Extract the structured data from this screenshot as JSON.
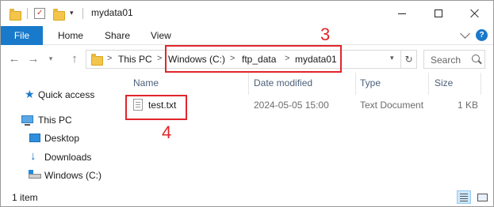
{
  "window": {
    "title": "mydata01",
    "controls": {
      "minimize": "minimize",
      "maximize": "maximize",
      "close": "close"
    }
  },
  "ribbon": {
    "tabs": [
      "File",
      "Home",
      "Share",
      "View"
    ],
    "help_label": "?"
  },
  "address": {
    "root": "This PC",
    "path": [
      "Windows (C:)",
      "ftp_data",
      "mydata01"
    ],
    "separator": ">",
    "search_placeholder": "Search"
  },
  "nav_pane": {
    "items": [
      {
        "label": "Quick access",
        "icon": "star-icon"
      },
      {
        "label": "This PC",
        "icon": "computer-icon"
      },
      {
        "label": "Desktop",
        "icon": "desktop-folder-icon"
      },
      {
        "label": "Downloads",
        "icon": "download-arrow-icon"
      },
      {
        "label": "Windows (C:)",
        "icon": "drive-icon"
      }
    ]
  },
  "file_list": {
    "columns": [
      "Name",
      "Date modified",
      "Type",
      "Size"
    ],
    "rows": [
      {
        "name": "test.txt",
        "date_modified": "2024-05-05 15:00",
        "type": "Text Document",
        "size": "1 KB"
      }
    ]
  },
  "status_bar": {
    "item_count": "1 item"
  },
  "annotations": {
    "address_marker": "3",
    "file_marker": "4",
    "color": "#e0262b"
  },
  "colors": {
    "accent": "#1979ca",
    "annotation": "#e0262b",
    "folder": "#f3c54b"
  }
}
